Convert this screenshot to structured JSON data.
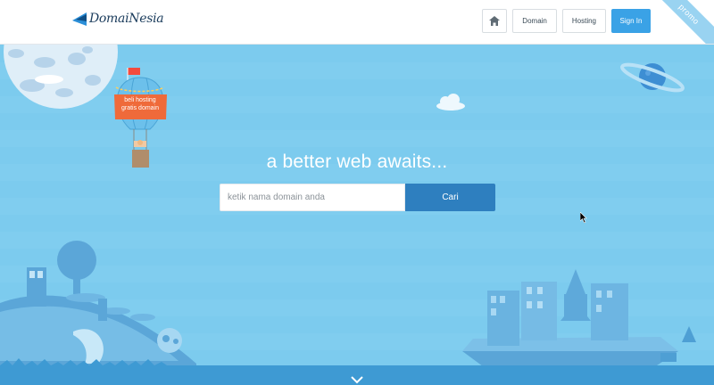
{
  "header": {
    "logo_text": "DomaiNesia",
    "nav": {
      "domain_label": "Domain",
      "hosting_label": "Hosting",
      "signin_label": "Sign In"
    },
    "promo_label": "promo"
  },
  "hero": {
    "headline": "a better web awaits...",
    "search": {
      "placeholder": "ketik nama domain anda",
      "button_label": "Cari"
    },
    "balloon_text": [
      "beli hosting",
      "gratis domain"
    ]
  },
  "colors": {
    "sky": "#7ccbee",
    "primary_button": "#2e7fbf",
    "signin_button": "#3aa2e6",
    "balloon_orange": "#ef6a3a"
  },
  "icons": [
    "home-icon",
    "chevron-down-icon",
    "mouse-cursor-icon"
  ]
}
